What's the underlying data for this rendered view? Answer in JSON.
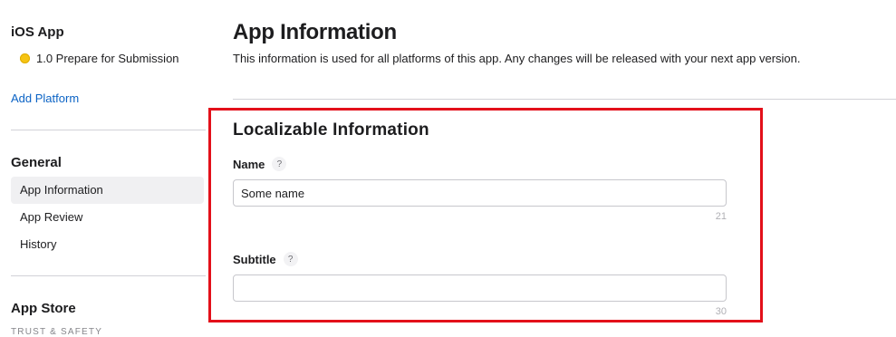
{
  "sidebar": {
    "platform_title": "iOS App",
    "version": {
      "label": "1.0 Prepare for Submission",
      "status_color": "#f6c413"
    },
    "add_platform_label": "Add Platform",
    "general": {
      "title": "General",
      "items": [
        {
          "label": "App Information",
          "active": true
        },
        {
          "label": "App Review",
          "active": false
        },
        {
          "label": "History",
          "active": false
        }
      ]
    },
    "app_store": {
      "title": "App Store",
      "subsection_label": "TRUST & SAFETY"
    }
  },
  "main": {
    "title": "App Information",
    "description": "This information is used for all platforms of this app. Any changes will be released with your next app version.",
    "localizable": {
      "title": "Localizable Information",
      "highlight_color": "#e3101a",
      "fields": {
        "name": {
          "label": "Name",
          "help": "?",
          "value": "Some name",
          "remaining": "21"
        },
        "subtitle": {
          "label": "Subtitle",
          "help": "?",
          "value": "",
          "remaining": "30"
        }
      }
    }
  },
  "colors": {
    "link": "#0b63c5",
    "text": "#1d1d1f",
    "muted": "#86868b",
    "divider": "#d2d2d7"
  }
}
